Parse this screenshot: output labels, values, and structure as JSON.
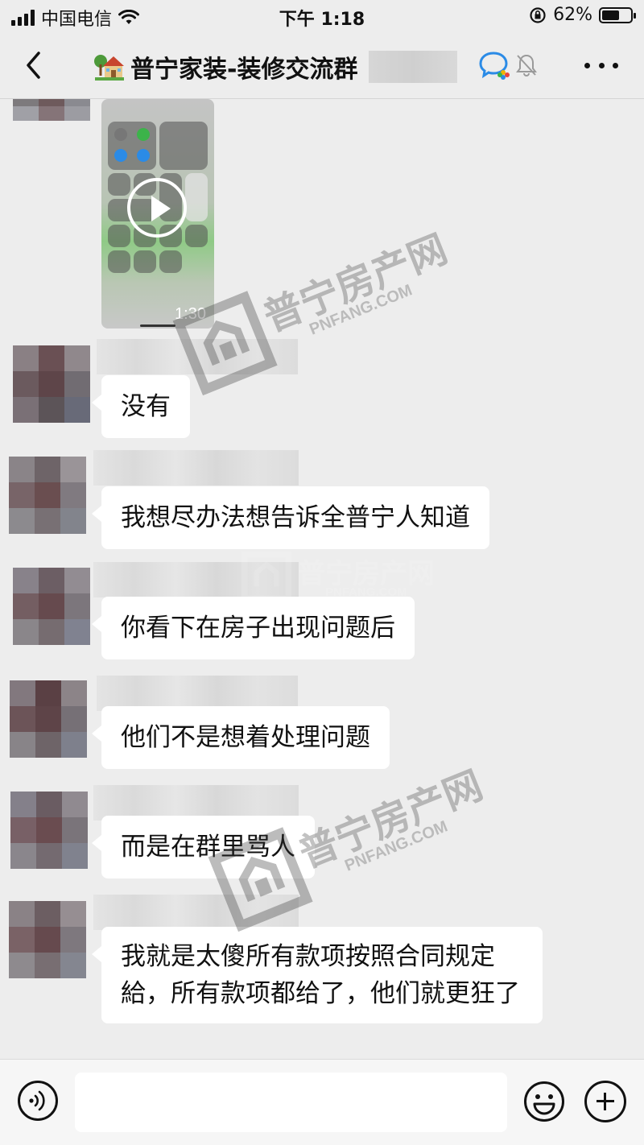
{
  "status_bar": {
    "carrier": "中国电信",
    "time": "下午 1:18",
    "battery": "62%",
    "battery_level": 0.62
  },
  "nav": {
    "title": "普宁家装-装修交流群",
    "title_icon": "house-with-garden-emoji",
    "icons": [
      "back-chevron-icon",
      "wecom-icon",
      "mute-bell-icon",
      "more-icon"
    ]
  },
  "watermark": {
    "brand": "普宁房产网",
    "domain": "PNFANG.COM"
  },
  "messages": [
    {
      "type": "video",
      "duration": "1:30"
    },
    {
      "type": "text",
      "text": "没有"
    },
    {
      "type": "text",
      "text": "我想尽办法想告诉全普宁人知道"
    },
    {
      "type": "text",
      "text": "你看下在房子出现问题后"
    },
    {
      "type": "text",
      "text": "他们不是想着处理问题"
    },
    {
      "type": "text",
      "text": "而是在群里骂人"
    },
    {
      "type": "text",
      "text": "我就是太傻所有款项按照合同规定給，所有款项都给了，他们就更狂了"
    }
  ],
  "input_bar": {
    "icons": [
      "voice-icon",
      "emoji-icon",
      "plus-icon"
    ],
    "value": ""
  }
}
